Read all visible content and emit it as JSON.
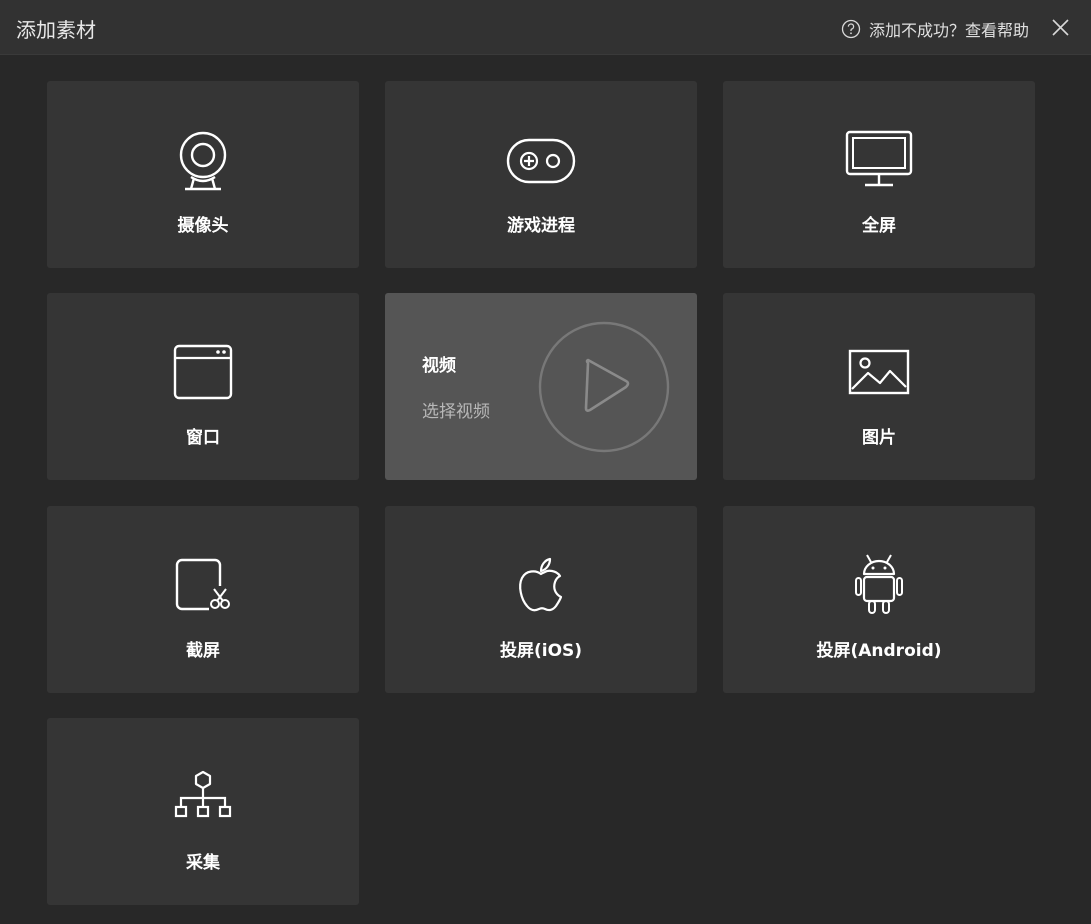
{
  "header": {
    "title": "添加素材",
    "help_text": "添加不成功？查看帮助"
  },
  "tiles": [
    {
      "label": "摄像头",
      "icon": "webcam-icon"
    },
    {
      "label": "游戏进程",
      "icon": "gamepad-icon"
    },
    {
      "label": "全屏",
      "icon": "monitor-icon"
    },
    {
      "label": "窗口",
      "icon": "window-icon"
    },
    {
      "label": "视频",
      "sublabel": "选择视频",
      "icon": "play-icon"
    },
    {
      "label": "图片",
      "icon": "image-icon"
    },
    {
      "label": "截屏",
      "icon": "screenshot-icon"
    },
    {
      "label": "投屏(iOS)",
      "icon": "apple-icon"
    },
    {
      "label": "投屏(Android)",
      "icon": "android-icon"
    },
    {
      "label": "采集",
      "icon": "network-tree-icon"
    }
  ],
  "colors": {
    "background": "#282828",
    "titlebar": "#323232",
    "tile": "#353535",
    "tile_active": "#555555",
    "text": "#ffffff",
    "subtext": "#b8b8b8"
  }
}
